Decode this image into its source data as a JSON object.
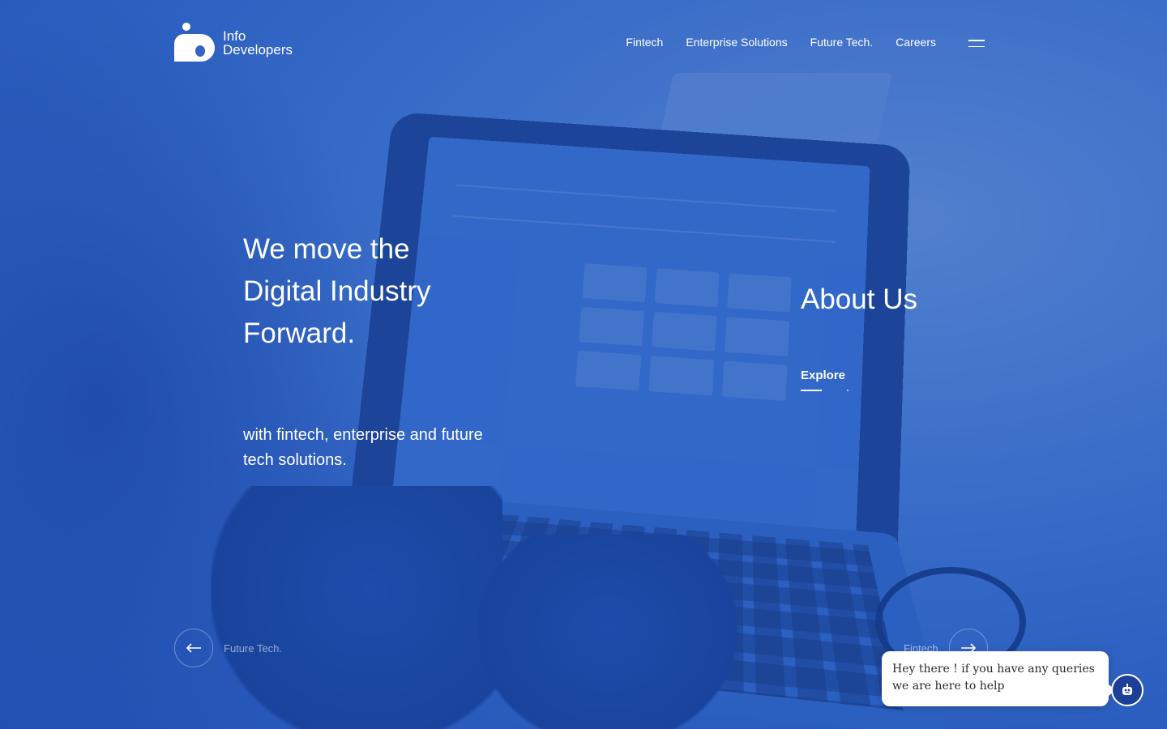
{
  "brand": {
    "line1": "Info",
    "line2": "Developers"
  },
  "nav": {
    "items": [
      {
        "label": "Fintech"
      },
      {
        "label": "Enterprise Solutions"
      },
      {
        "label": "Future Tech."
      },
      {
        "label": "Careers"
      }
    ],
    "menu_icon": "hamburger-icon"
  },
  "hero": {
    "headline": [
      "We move the",
      "Digital Industry",
      "Forward."
    ],
    "subline": "with fintech, enterprise and future tech solutions."
  },
  "about": {
    "title": "About Us",
    "cta": "Explore"
  },
  "slider": {
    "prev_label": "Future Tech.",
    "next_label": "Fintech"
  },
  "chat": {
    "message": "Hey there ! if you have any queries we are here to help",
    "icon": "robot-icon"
  },
  "colors": {
    "overlay": "#2e63c2",
    "text": "#ffffff",
    "chat_button": "#1d3f9a"
  }
}
